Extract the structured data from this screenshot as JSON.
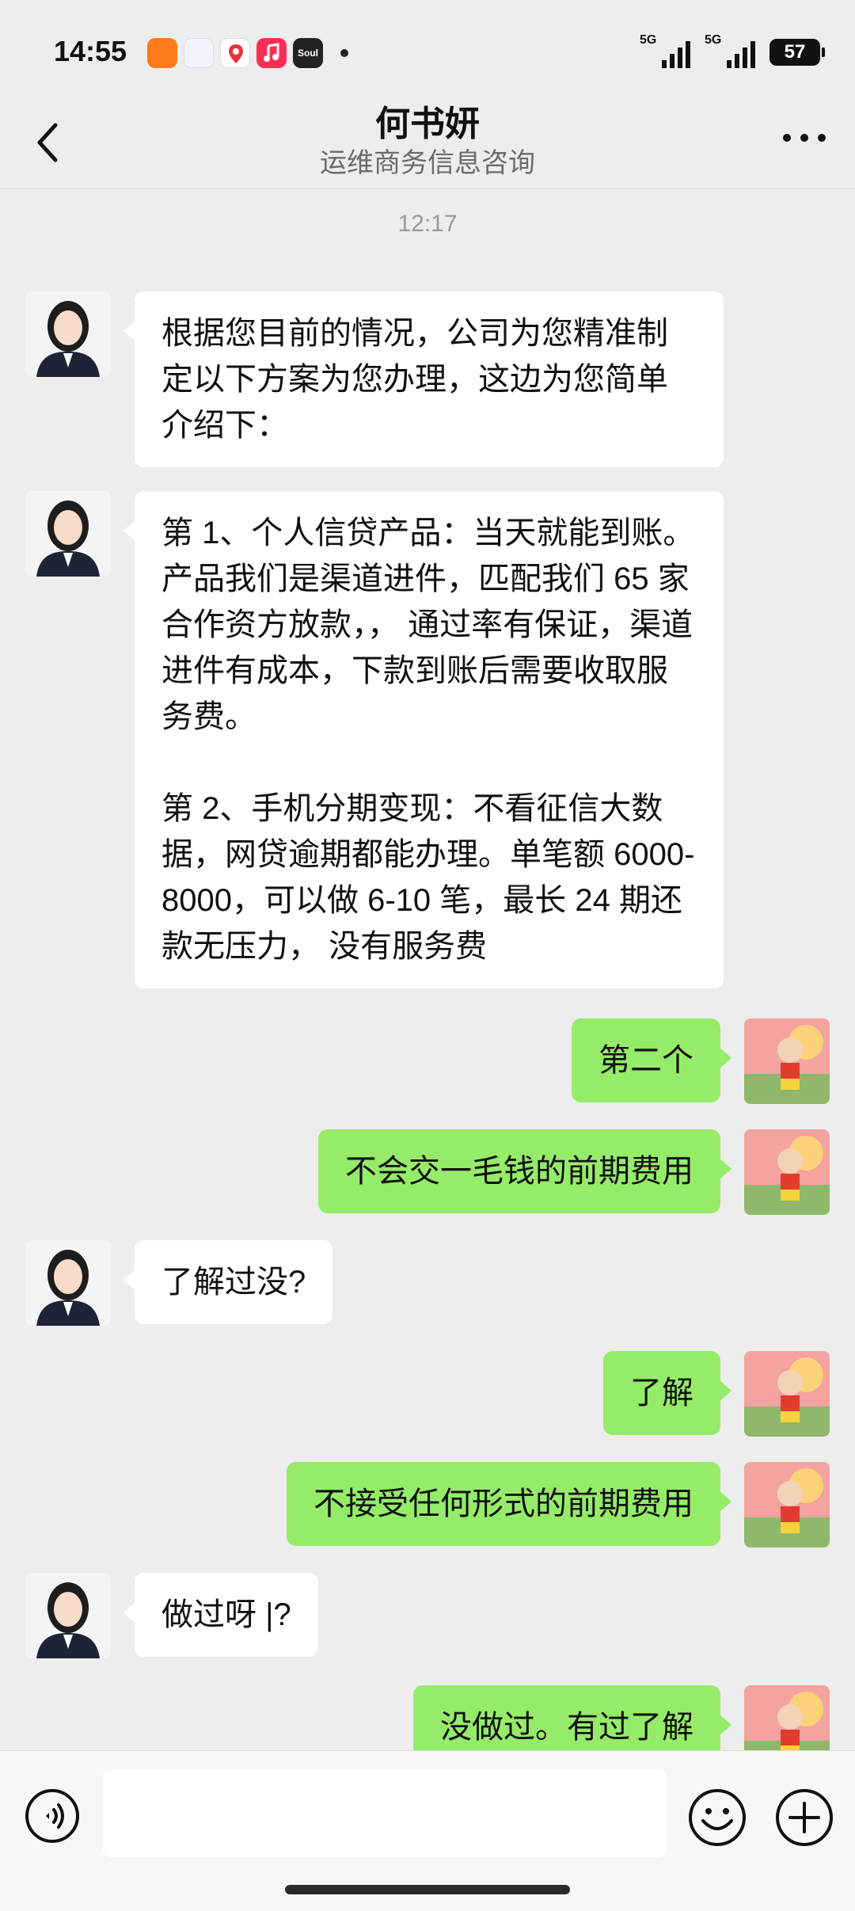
{
  "status_bar": {
    "time": "14:55",
    "app_icons": [
      "app-orange-icon",
      "app-flower-icon",
      "app-map-pin-icon",
      "app-music-icon",
      "soul-app-icon"
    ],
    "soul_label": "Soul",
    "signal1_label": "5G",
    "signal2_label": "5G",
    "battery": "57"
  },
  "header": {
    "title": "何书妍",
    "subtitle": "运维商务信息咨询"
  },
  "timestamp": "12:17",
  "messages": [
    {
      "side": "left",
      "text": "根据您目前的情况，公司为您精准制定以下方案为您办理，这边为您简单介绍下："
    },
    {
      "side": "left",
      "text": "第 1、个人信贷产品：当天就能到账。产品我们是渠道进件，匹配我们 65 家合作资方放款，， 通过率有保证，渠道进件有成本，下款到账后需要收取服务费。\n\n第 2、手机分期变现：不看征信大数据，网贷逾期都能办理。单笔额 6000-8000，可以做 6-10 笔，最长 24 期还款无压力， 没有服务费"
    },
    {
      "side": "right",
      "text": "第二个"
    },
    {
      "side": "right",
      "text": "不会交一毛钱的前期费用"
    },
    {
      "side": "left",
      "text": "了解过没?"
    },
    {
      "side": "right",
      "text": "了解"
    },
    {
      "side": "right",
      "text": "不接受任何形式的前期费用"
    },
    {
      "side": "left",
      "text": "做过呀 |?"
    },
    {
      "side": "right",
      "text": "没做过。有过了解"
    }
  ],
  "input_bar": {
    "placeholder": "",
    "icons": [
      "voice-icon",
      "emoji-icon",
      "plus-icon"
    ]
  },
  "colors": {
    "background": "#ededed",
    "self_bubble": "#95ec69",
    "other_bubble": "#ffffff"
  }
}
